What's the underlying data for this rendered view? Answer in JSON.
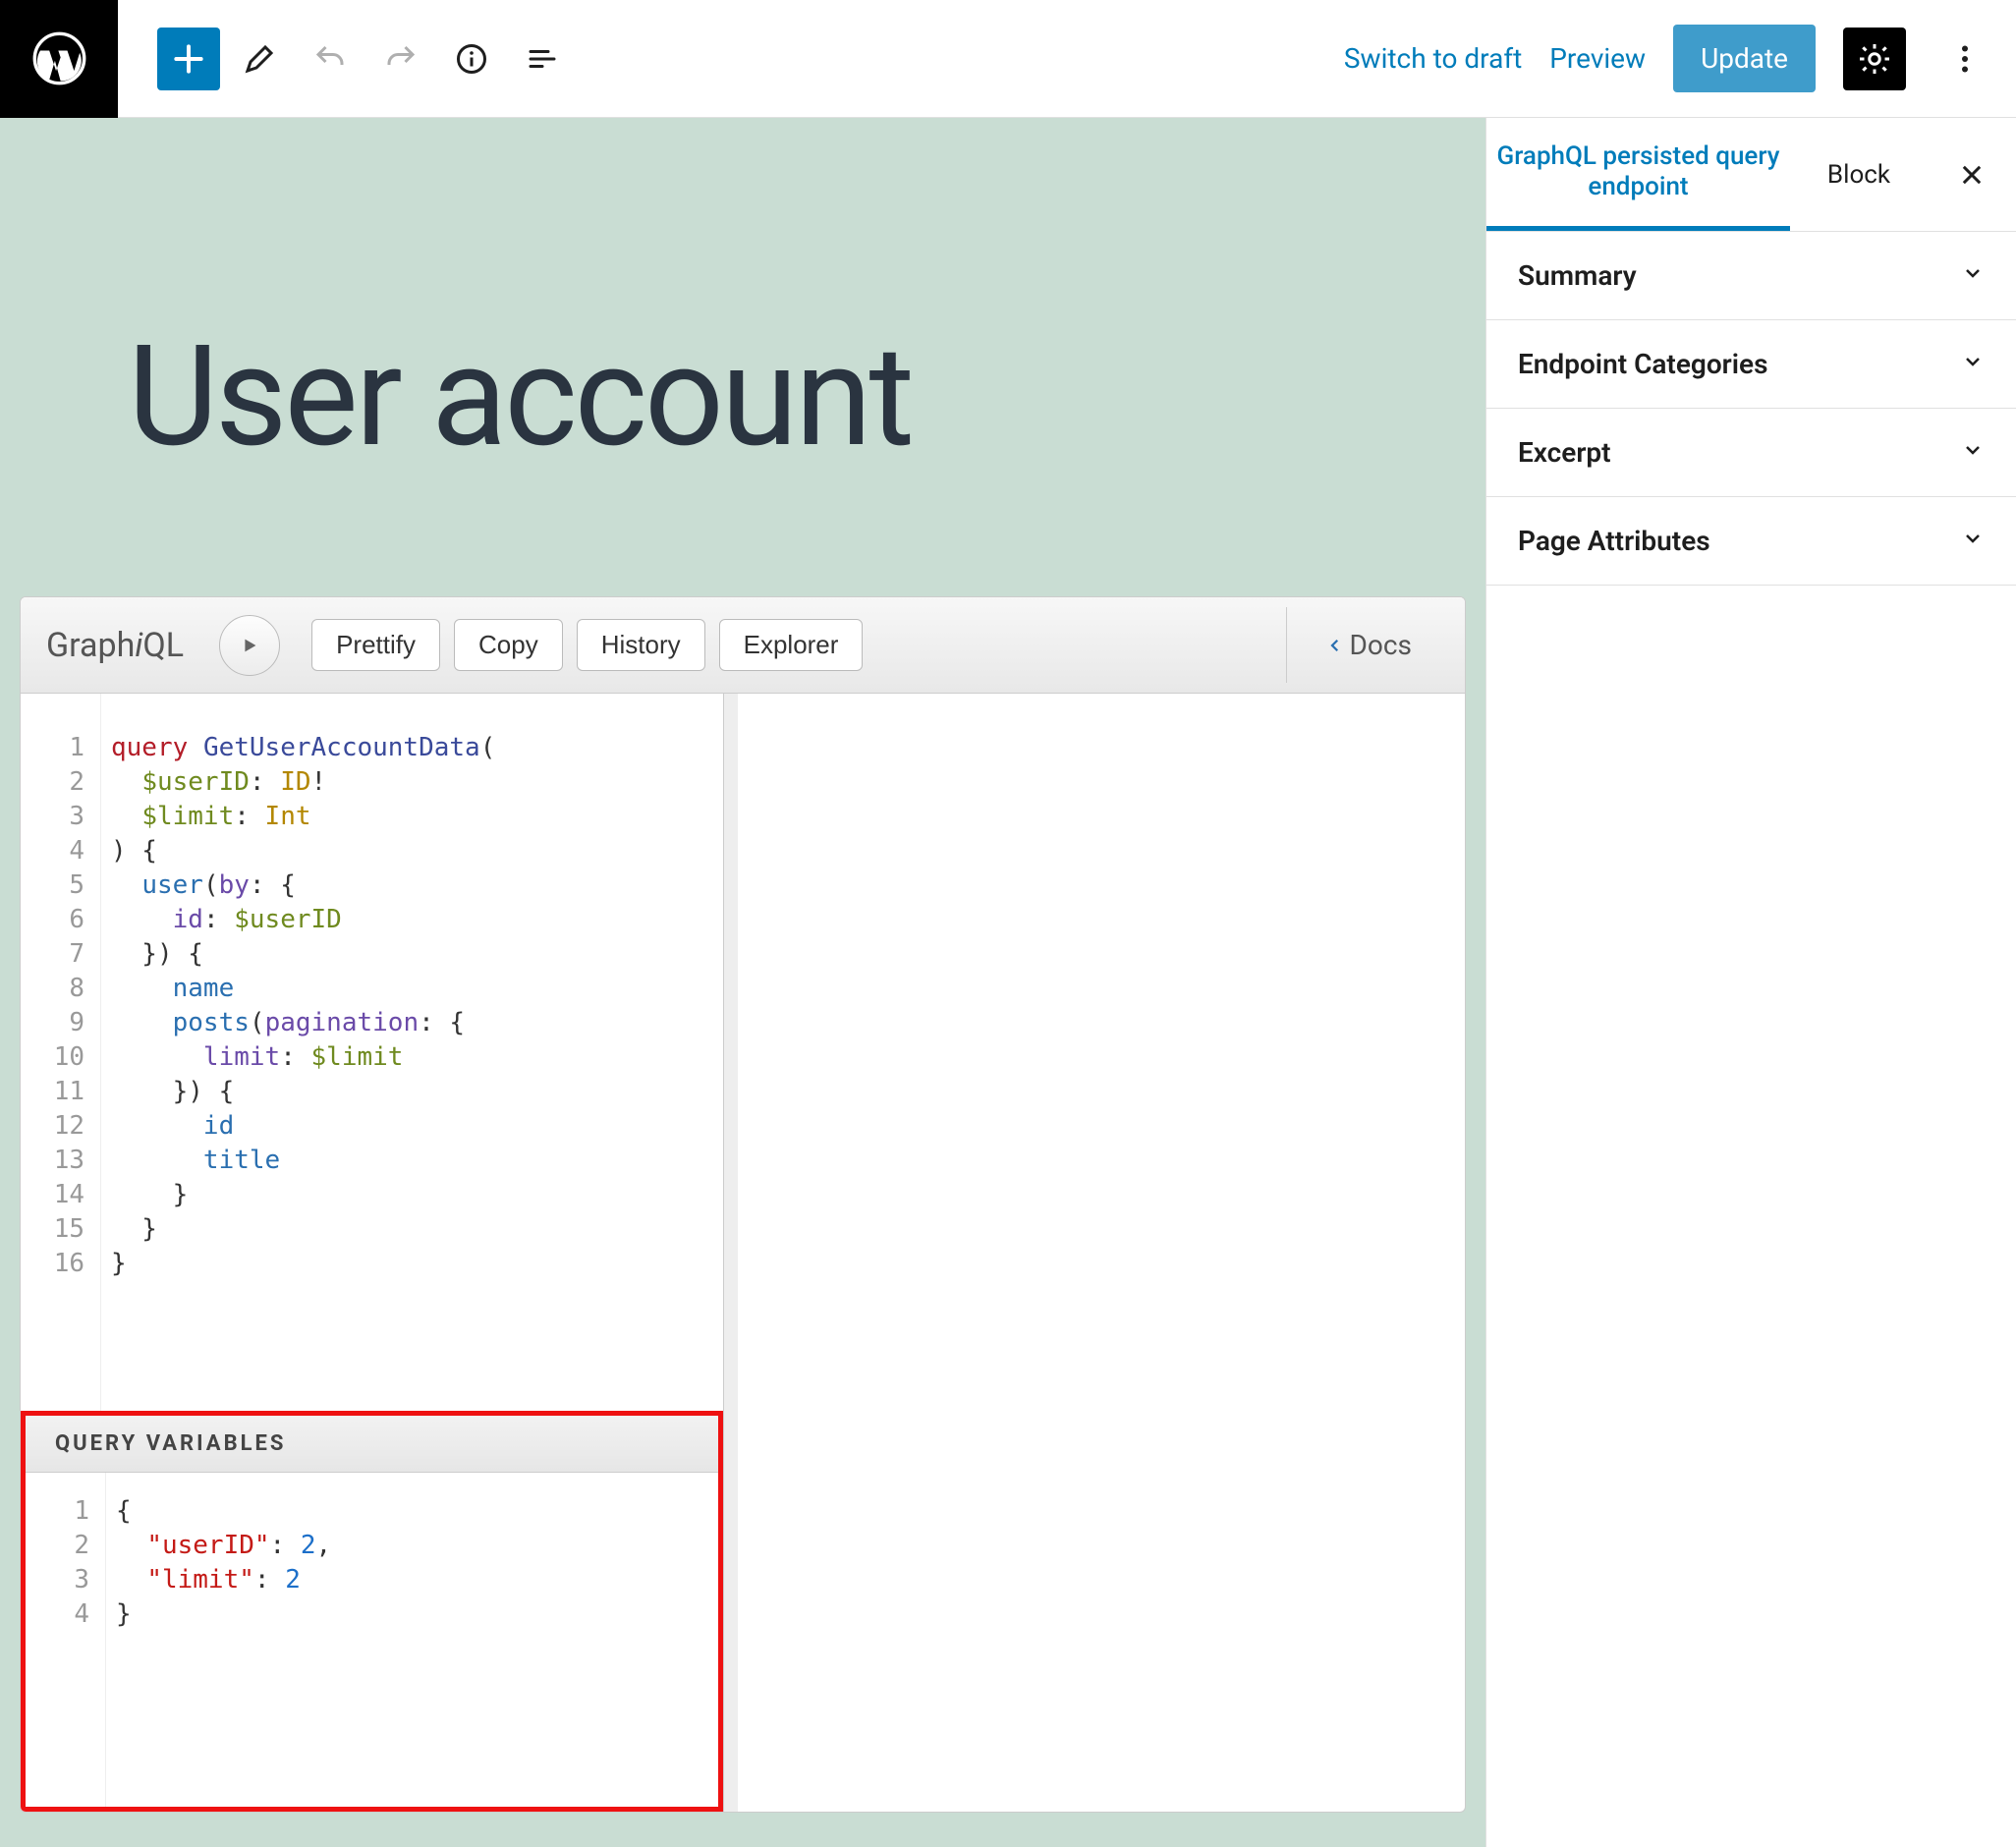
{
  "topbar": {
    "switch_draft": "Switch to draft",
    "preview": "Preview",
    "update": "Update"
  },
  "page": {
    "title": "User account"
  },
  "graphiql": {
    "logo_prefix": "Graph",
    "logo_i": "i",
    "logo_suffix": "QL",
    "buttons": {
      "prettify": "Prettify",
      "copy": "Copy",
      "history": "History",
      "explorer": "Explorer"
    },
    "docs": "Docs",
    "vars_header": "QUERY VARIABLES",
    "query_lines": [
      "1",
      "2",
      "3",
      "4",
      "5",
      "6",
      "7",
      "8",
      "9",
      "10",
      "11",
      "12",
      "13",
      "14",
      "15",
      "16"
    ],
    "var_lines": [
      "1",
      "2",
      "3",
      "4"
    ],
    "query": {
      "kw_query": "query",
      "op_name": "GetUserAccountData",
      "var_userID": "$userID",
      "type_ID": "ID",
      "excl": "!",
      "var_limit": "$limit",
      "type_Int": "Int",
      "user": "user",
      "by": "by",
      "id": "id",
      "name": "name",
      "posts": "posts",
      "pagination": "pagination",
      "limit": "limit",
      "title": "title"
    },
    "vars": {
      "userID_key": "\"userID\"",
      "userID_val": "2",
      "limit_key": "\"limit\"",
      "limit_val": "2"
    }
  },
  "sidebar": {
    "tab1": "GraphQL persisted query endpoint",
    "tab2": "Block",
    "panels": {
      "summary": "Summary",
      "categories": "Endpoint Categories",
      "excerpt": "Excerpt",
      "attrs": "Page Attributes"
    }
  }
}
